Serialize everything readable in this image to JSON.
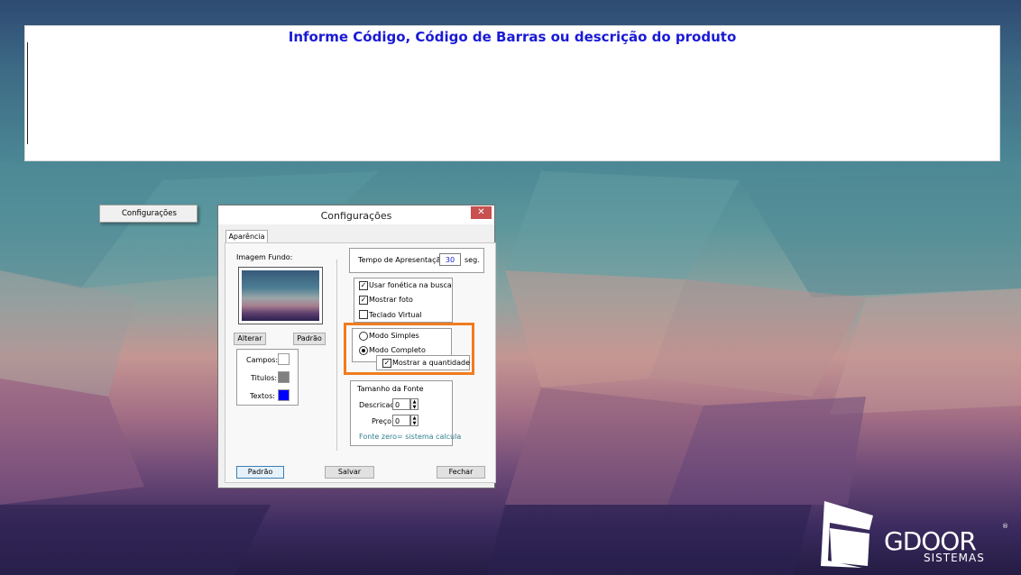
{
  "search_panel": {
    "title": "Informe Código, Código de Barras ou descrição do produto"
  },
  "context_menu": {
    "item": "Configurações"
  },
  "dialog": {
    "title": "Configurações",
    "close_label": "✕",
    "tab_label": "Aparência",
    "background_image_label": "Imagem Fundo:",
    "alterar_button": "Alterar",
    "padrao_small_button": "Padrão",
    "color_settings": {
      "campos_label": "Campos:",
      "campos_color": "#ffffff",
      "titulos_label": "Titulos:",
      "titulos_color": "#808080",
      "textos_label": "Textos:",
      "textos_color": "#0000ff"
    },
    "tempo_label": "Tempo de Apresentação:",
    "tempo_value": "30",
    "tempo_unit": "seg.",
    "usar_fonetica_label": "Usar fonética na busca",
    "usar_fonetica_checked": true,
    "mostrar_foto_label": "Mostrar foto",
    "mostrar_foto_checked": true,
    "teclado_virtual_label": "Teclado Virtual",
    "teclado_virtual_checked": false,
    "modo_simples_label": "Modo Simples",
    "modo_completo_label": "Modo Completo",
    "selected_mode": "Modo Completo",
    "mostrar_quantidade_label": "Mostrar a quantidade",
    "mostrar_quantidade_checked": true,
    "font_size_group_label": "Tamanho da Fonte",
    "descricao_label": "Descricao",
    "descricao_value": "0",
    "preco_label": "Preço",
    "preco_value": "0",
    "font_hint": "Fonte zero= sistema calcula",
    "padrao_button": "Padrão",
    "salvar_button": "Salvar",
    "fechar_button": "Fechar"
  },
  "logo": {
    "brand": "GDOOR",
    "subtitle": "SISTEMAS",
    "registered": "®"
  },
  "colors": {
    "title_blue": "#1a1ad6",
    "highlight_orange": "#f07c1f",
    "close_red": "#c75050",
    "hint_teal": "#2f7f8f"
  }
}
